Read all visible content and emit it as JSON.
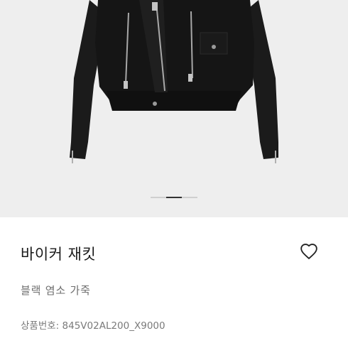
{
  "gallery": {
    "image_alt": "black leather biker jacket",
    "pager": {
      "count": 3,
      "active_index": 1
    }
  },
  "product": {
    "name": "바이커 재킷",
    "material": "블랙 염소 가죽",
    "sku_label": "상품번호:",
    "sku": "845V02AL200_X9000",
    "wishlist_icon": "heart-outline-icon"
  }
}
